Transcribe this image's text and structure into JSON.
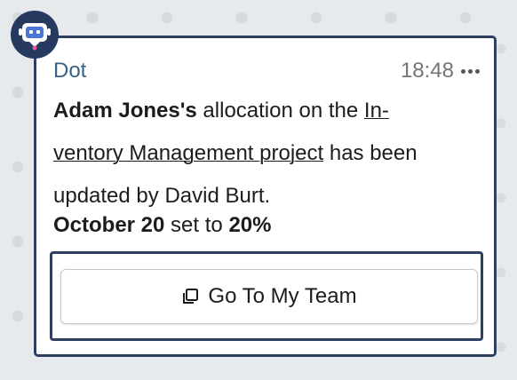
{
  "message": {
    "sender": "Dot",
    "time": "18:48",
    "more_icon": "more-horizontal-icon",
    "avatar_icon": "robot-bot-icon",
    "body": {
      "person": "Adam Jones's",
      "text_1": " allocation on the ",
      "link_line1": "In-",
      "link_line2": "ventory Management project",
      "text_2_line2": " has been",
      "text_2_line3": "updated by David Burt."
    },
    "summary": {
      "date": "October 20",
      "text": " set to ",
      "value": "20%"
    },
    "action": {
      "label": "Go To My Team",
      "icon": "external-window-icon"
    }
  },
  "colors": {
    "sender": "#3a6189",
    "border": "#2f3f5f",
    "avatar_bg": "#253a5e",
    "background": "#e6eaec"
  }
}
